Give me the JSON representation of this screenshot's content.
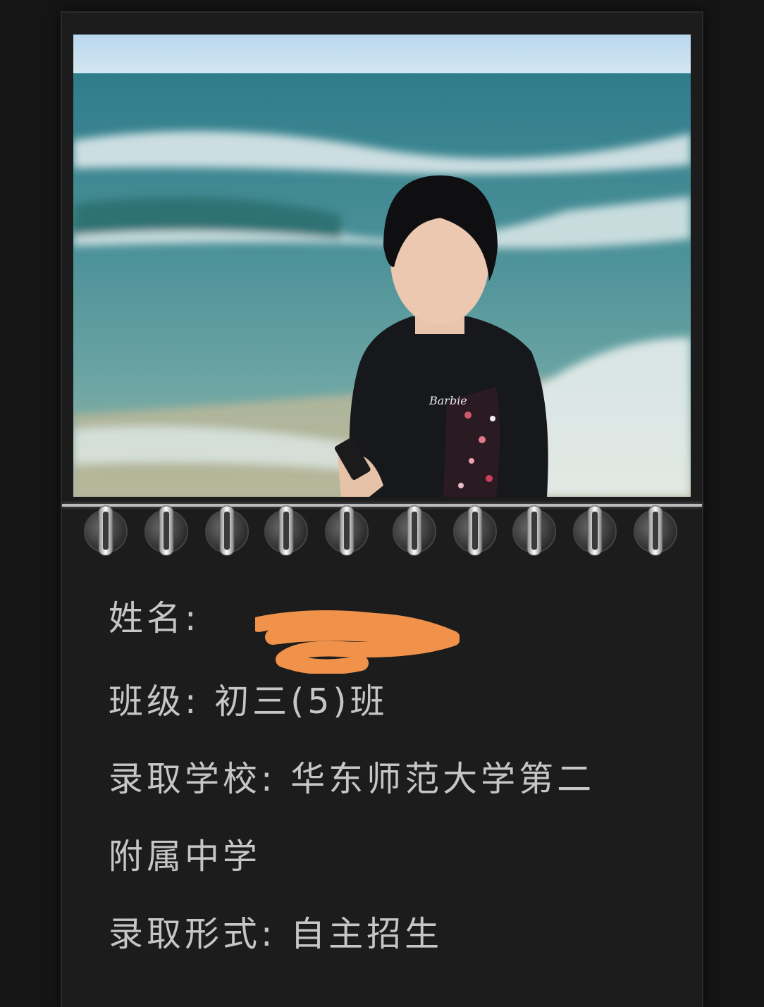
{
  "profile": {
    "name_label": "姓名:",
    "class_label": "班级:",
    "class_value": "初三(5)班",
    "school_label": "录取学校:",
    "school_value_line1": "华东师范大学第二",
    "school_value_line2": "附属中学",
    "admission_label": "录取形式:",
    "admission_value": "自主招生"
  },
  "photo": {
    "shirt_logo": "Barbie"
  },
  "colors": {
    "background": "#151515",
    "card": "#1c1c1c",
    "text": "#c6c6c6",
    "redaction": "#f0924a"
  }
}
